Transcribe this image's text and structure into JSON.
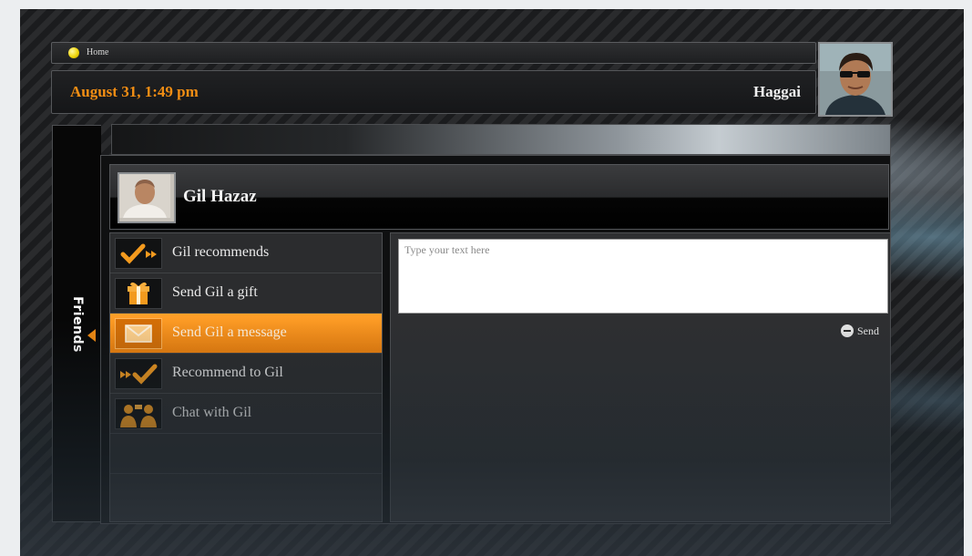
{
  "header": {
    "breadcrumb": "Home",
    "datetime": "August 31, 1:49 pm",
    "user_name": "Haggai"
  },
  "sidebar": {
    "tab_label": "Friends"
  },
  "profile": {
    "name": "Gil Hazaz"
  },
  "menu": {
    "items": [
      {
        "label": "Gil recommends",
        "icon": "check-arrow-icon",
        "active": false
      },
      {
        "label": "Send Gil a gift",
        "icon": "gift-icon",
        "active": false
      },
      {
        "label": "Send Gil a message",
        "icon": "envelope-icon",
        "active": true
      },
      {
        "label": "Recommend to Gil",
        "icon": "arrow-check-icon",
        "active": false
      },
      {
        "label": "Chat with Gil",
        "icon": "people-chat-icon",
        "active": false
      }
    ]
  },
  "message": {
    "placeholder": "Type your text here",
    "send_label": "Send"
  },
  "colors": {
    "accent": "#f28e14",
    "active_item": "#f8941c",
    "home_dot": "#f1d70c"
  }
}
